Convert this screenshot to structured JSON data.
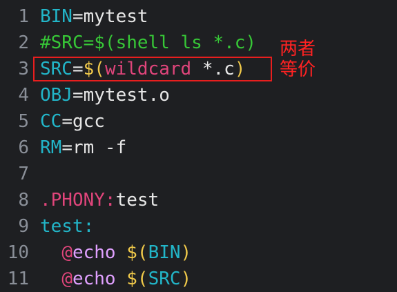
{
  "lines": [
    {
      "num": "1",
      "tokens": [
        {
          "t": "BIN",
          "c": "var"
        },
        {
          "t": "=mytest",
          "c": "plain"
        }
      ]
    },
    {
      "num": "2",
      "tokens": [
        {
          "t": "#SRC=$(shell ls *.c)",
          "c": "comment"
        }
      ]
    },
    {
      "num": "3",
      "tokens": [
        {
          "t": "SRC",
          "c": "var"
        },
        {
          "t": "=",
          "c": "plain"
        },
        {
          "t": "$(",
          "c": "dollar"
        },
        {
          "t": "wildcard",
          "c": "fn"
        },
        {
          "t": " *.c",
          "c": "plain"
        },
        {
          "t": ")",
          "c": "dollar"
        }
      ]
    },
    {
      "num": "4",
      "tokens": [
        {
          "t": "OBJ",
          "c": "var"
        },
        {
          "t": "=mytest.o",
          "c": "plain"
        }
      ]
    },
    {
      "num": "5",
      "tokens": [
        {
          "t": "CC",
          "c": "var"
        },
        {
          "t": "=gcc",
          "c": "plain"
        }
      ]
    },
    {
      "num": "6",
      "tokens": [
        {
          "t": "RM",
          "c": "var"
        },
        {
          "t": "=rm -f",
          "c": "plain"
        }
      ]
    },
    {
      "num": "7",
      "tokens": []
    },
    {
      "num": "8",
      "tokens": [
        {
          "t": ".PHONY:",
          "c": "phony"
        },
        {
          "t": "test",
          "c": "plain"
        }
      ]
    },
    {
      "num": "9",
      "tokens": [
        {
          "t": "test:",
          "c": "target"
        }
      ]
    },
    {
      "num": "10",
      "tokens": [
        {
          "t": "  ",
          "c": "plain"
        },
        {
          "t": "@",
          "c": "at"
        },
        {
          "t": "echo",
          "c": "echo"
        },
        {
          "t": " ",
          "c": "plain"
        },
        {
          "t": "$(",
          "c": "dollar"
        },
        {
          "t": "BIN",
          "c": "var"
        },
        {
          "t": ")",
          "c": "dollar"
        }
      ]
    },
    {
      "num": "11",
      "tokens": [
        {
          "t": "  ",
          "c": "plain"
        },
        {
          "t": "@",
          "c": "at"
        },
        {
          "t": "echo",
          "c": "echo"
        },
        {
          "t": " ",
          "c": "plain"
        },
        {
          "t": "$(",
          "c": "dollar"
        },
        {
          "t": "SRC",
          "c": "var"
        },
        {
          "t": ")",
          "c": "dollar"
        }
      ]
    }
  ],
  "annotation": {
    "line1": "两者",
    "line2": "等价"
  },
  "colors": {
    "background": "#1e1f22",
    "highlight_box": "#e81e1e",
    "annotation_text": "#ff2222"
  }
}
